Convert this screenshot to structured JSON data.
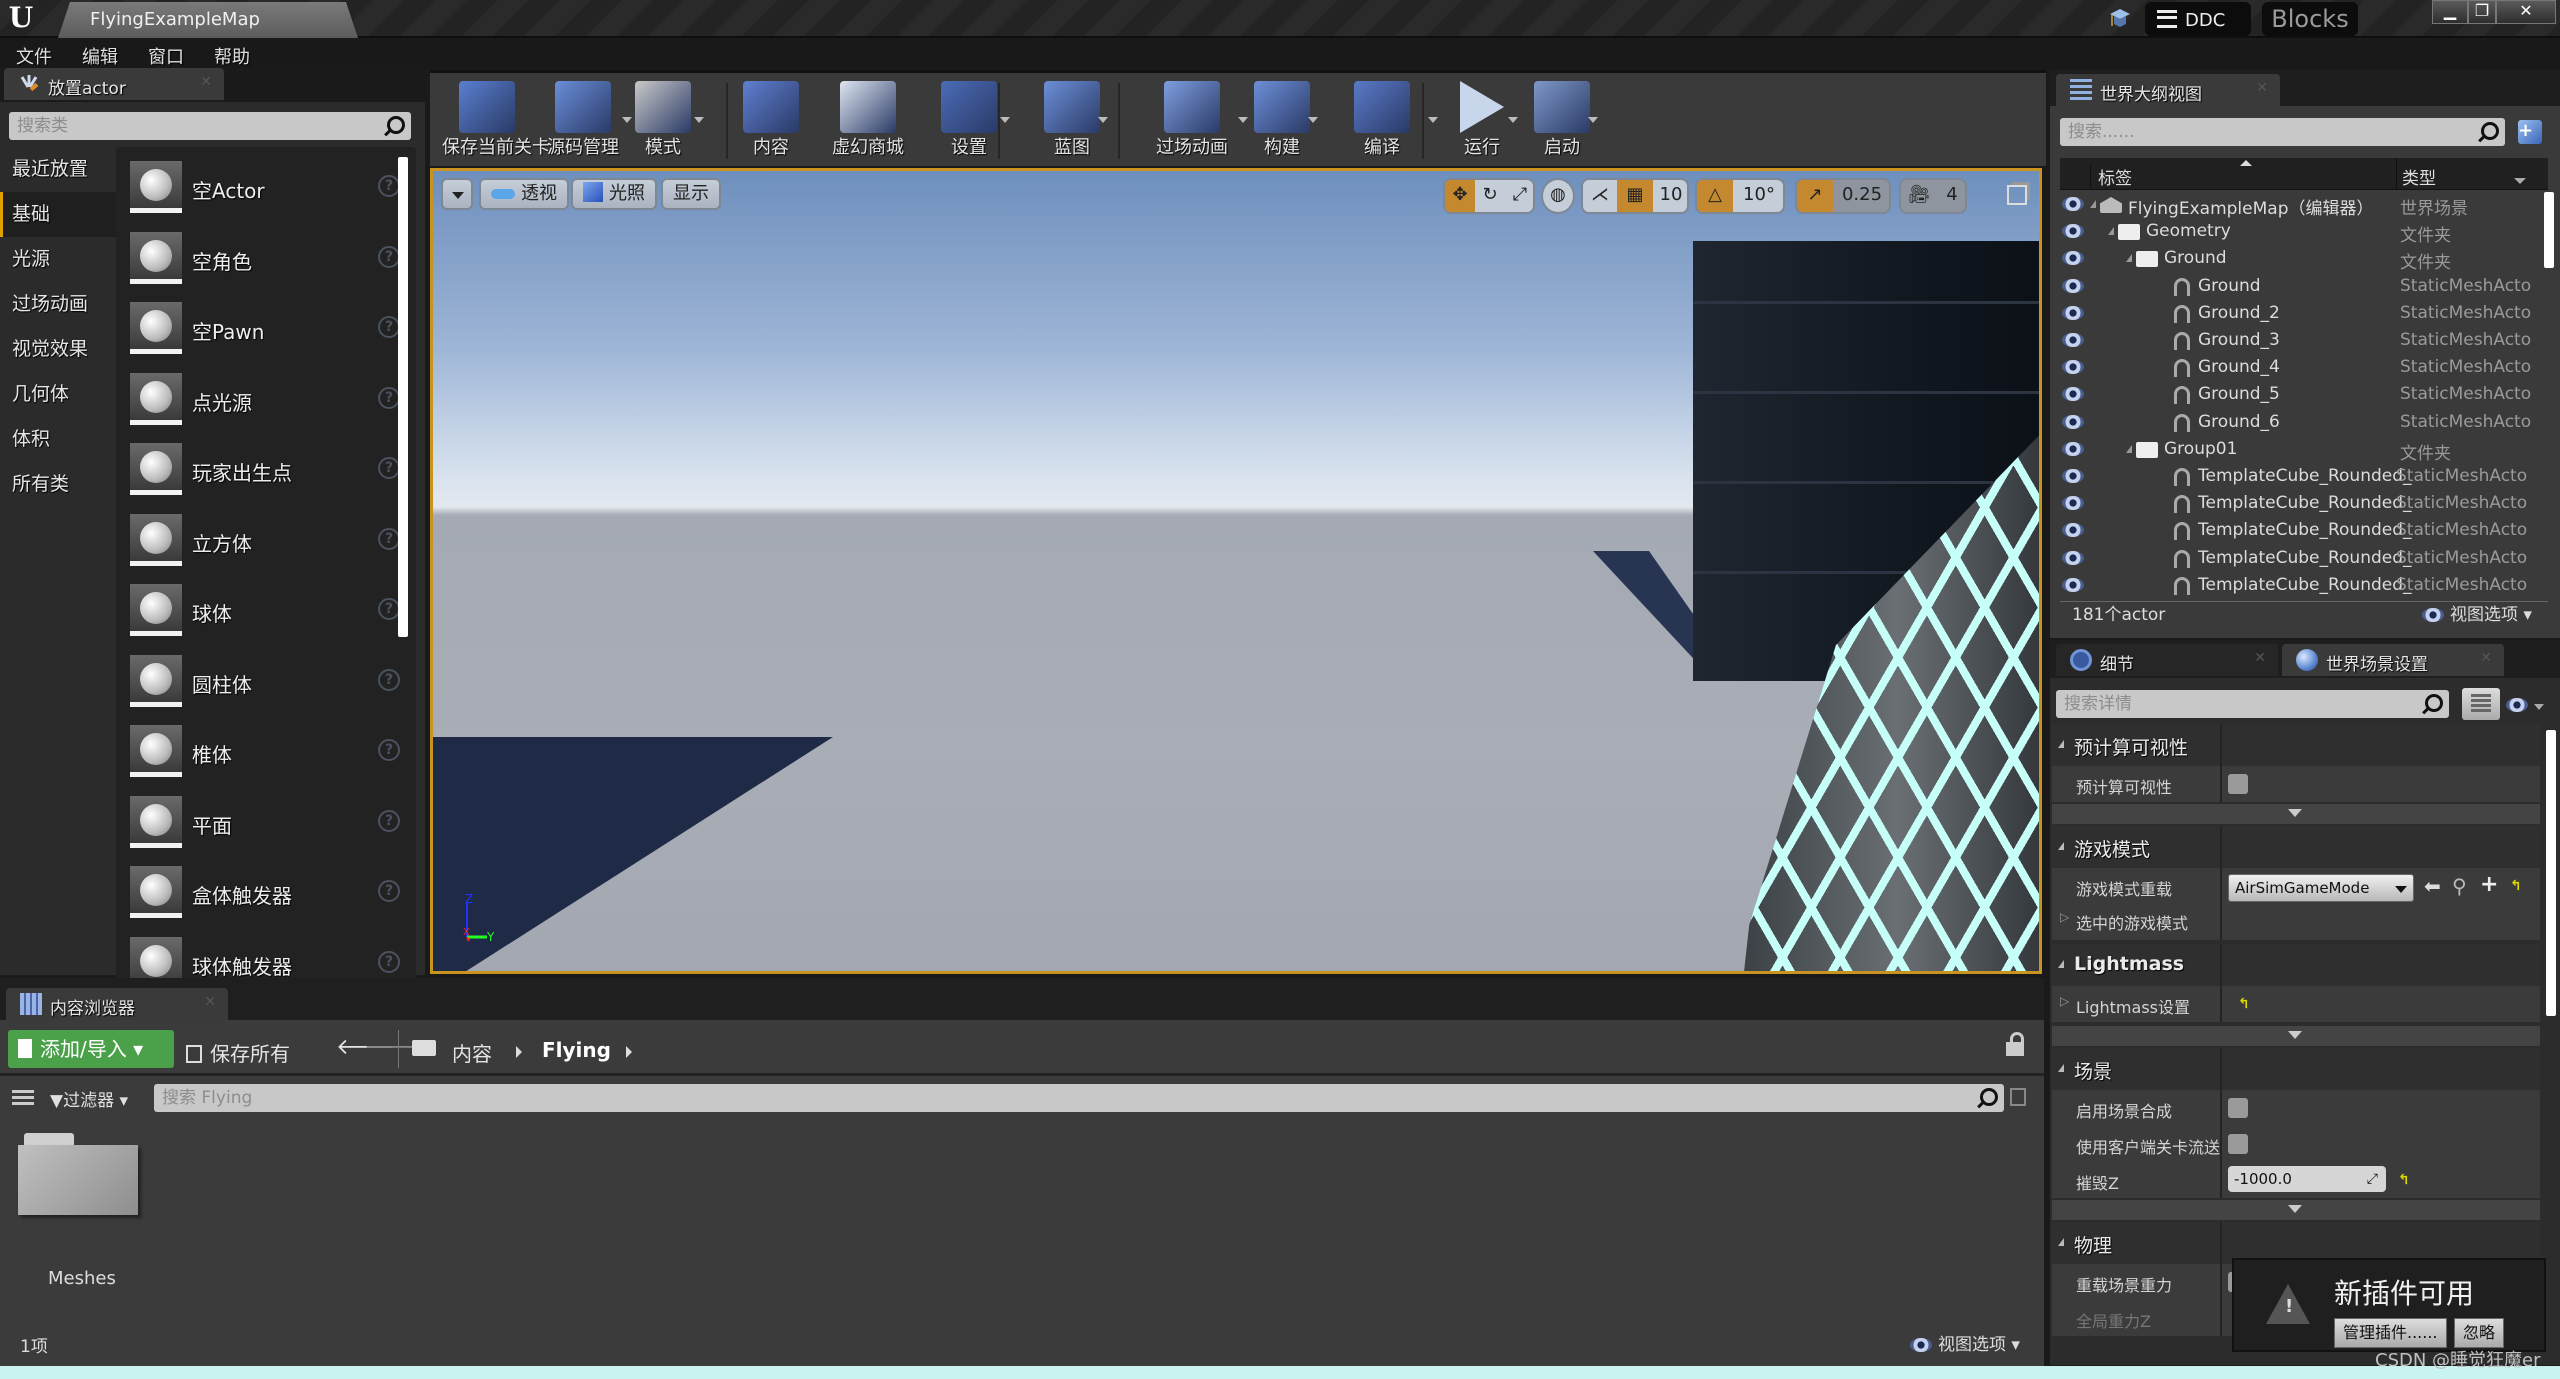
{
  "window": {
    "doc_tab": "FlyingExampleMap",
    "ddc_label": "DDC",
    "project_badge": "Blocks",
    "controls": {
      "minimize": "▁",
      "restore": "❐",
      "close": "✕"
    }
  },
  "menu": [
    "文件",
    "编辑",
    "窗口",
    "帮助"
  ],
  "place_actor": {
    "tab_label": "放置actor",
    "search_placeholder": "搜索类",
    "categories": [
      {
        "label": "最近放置",
        "active": false
      },
      {
        "label": "基础",
        "active": true
      },
      {
        "label": "光源",
        "active": false
      },
      {
        "label": "过场动画",
        "active": false
      },
      {
        "label": "视觉效果",
        "active": false
      },
      {
        "label": "几何体",
        "active": false
      },
      {
        "label": "体积",
        "active": false
      },
      {
        "label": "所有类",
        "active": false
      }
    ],
    "actors": [
      {
        "name": "空Actor",
        "icon": "sphere-icon"
      },
      {
        "name": "空角色",
        "icon": "mannequin-icon"
      },
      {
        "name": "空Pawn",
        "icon": "pawn-icon"
      },
      {
        "name": "点光源",
        "icon": "lightbulb-icon"
      },
      {
        "name": "玩家出生点",
        "icon": "player-start-icon"
      },
      {
        "name": "立方体",
        "icon": "cube-icon"
      },
      {
        "name": "球体",
        "icon": "sphere-icon"
      },
      {
        "name": "圆柱体",
        "icon": "cylinder-icon"
      },
      {
        "name": "椎体",
        "icon": "cone-icon"
      },
      {
        "name": "平面",
        "icon": "plane-icon"
      },
      {
        "name": "盒体触发器",
        "icon": "box-trigger-icon"
      },
      {
        "name": "球体触发器",
        "icon": "sphere-trigger-icon"
      }
    ],
    "help_glyph": "?"
  },
  "toolbar": {
    "buttons": [
      {
        "label": "保存当前关卡",
        "icon": "save-icon",
        "dropdown": false
      },
      {
        "label": "源码管理",
        "icon": "source-control-icon",
        "dropdown": true
      },
      {
        "label": "模式",
        "icon": "modes-icon",
        "dropdown": true
      },
      {
        "label": "内容",
        "icon": "content-icon",
        "dropdown": false
      },
      {
        "label": "虚幻商城",
        "icon": "marketplace-icon",
        "dropdown": false
      },
      {
        "label": "设置",
        "icon": "settings-icon",
        "dropdown": true
      },
      {
        "label": "蓝图",
        "icon": "blueprint-icon",
        "dropdown": true
      },
      {
        "label": "过场动画",
        "icon": "cinematics-icon",
        "dropdown": true
      },
      {
        "label": "构建",
        "icon": "build-icon",
        "dropdown": true
      },
      {
        "label": "编译",
        "icon": "compile-icon",
        "dropdown": true
      },
      {
        "label": "运行",
        "icon": "play-icon",
        "dropdown": true
      },
      {
        "label": "启动",
        "icon": "launch-icon",
        "dropdown": true
      }
    ]
  },
  "viewport": {
    "perspective_label": "透视",
    "lighting_label": "光照",
    "show_label": "显示",
    "grid_snap": "10",
    "rotation_snap": "10°",
    "scale_snap": "0.25",
    "camera_speed": "4",
    "axis_labels": {
      "z": "Z",
      "x": "X",
      "y": "Y"
    }
  },
  "outliner": {
    "tab_label": "世界大纲视图",
    "search_placeholder": "搜索......",
    "col_label": "标签",
    "col_type": "类型",
    "rows": [
      {
        "label": "FlyingExampleMap（编辑器）",
        "type": "世界场景",
        "depth": 0,
        "kind": "world"
      },
      {
        "label": "Geometry",
        "type": "文件夹",
        "depth": 1,
        "kind": "folder"
      },
      {
        "label": "Ground",
        "type": "文件夹",
        "depth": 2,
        "kind": "folder"
      },
      {
        "label": "Ground",
        "type": "StaticMeshActo",
        "depth": 3,
        "kind": "mesh"
      },
      {
        "label": "Ground_2",
        "type": "StaticMeshActo",
        "depth": 3,
        "kind": "mesh"
      },
      {
        "label": "Ground_3",
        "type": "StaticMeshActo",
        "depth": 3,
        "kind": "mesh"
      },
      {
        "label": "Ground_4",
        "type": "StaticMeshActo",
        "depth": 3,
        "kind": "mesh"
      },
      {
        "label": "Ground_5",
        "type": "StaticMeshActo",
        "depth": 3,
        "kind": "mesh"
      },
      {
        "label": "Ground_6",
        "type": "StaticMeshActo",
        "depth": 3,
        "kind": "mesh"
      },
      {
        "label": "Group01",
        "type": "文件夹",
        "depth": 2,
        "kind": "folder"
      },
      {
        "label": "TemplateCube_Rounded_",
        "type": "StaticMeshActo",
        "depth": 3,
        "kind": "mesh"
      },
      {
        "label": "TemplateCube_Rounded_",
        "type": "StaticMeshActo",
        "depth": 3,
        "kind": "mesh"
      },
      {
        "label": "TemplateCube_Rounded_",
        "type": "StaticMeshActo",
        "depth": 3,
        "kind": "mesh"
      },
      {
        "label": "TemplateCube_Rounded_",
        "type": "StaticMeshActo",
        "depth": 3,
        "kind": "mesh"
      },
      {
        "label": "TemplateCube_Rounded_",
        "type": "StaticMeshActo",
        "depth": 3,
        "kind": "mesh"
      }
    ],
    "actor_count": "181个actor",
    "view_options": "视图选项"
  },
  "details": {
    "tab_details": "细节",
    "tab_world_settings": "世界场景设置",
    "search_placeholder": "搜索详情",
    "sections": {
      "precomputed": {
        "title": "预计算可视性",
        "row": "预计算可视性"
      },
      "game_mode": {
        "title": "游戏模式",
        "override_label": "游戏模式重载",
        "override_value": "AirSimGameMode",
        "selected_label": "选中的游戏模式"
      },
      "lightmass": {
        "title": "Lightmass",
        "settings_label": "Lightmass设置"
      },
      "world": {
        "title": "场景",
        "composition_label": "启用场景合成",
        "streaming_label": "使用客户端关卡流送",
        "killz_label": "摧毁Z",
        "killz_value": "-1000.0"
      },
      "physics": {
        "title": "物理",
        "override_gravity_label": "重载场景重力",
        "global_gravity_label": "全局重力Z"
      }
    }
  },
  "toast": {
    "title": "新插件可用",
    "manage_label": "管理插件......",
    "dismiss_label": "忽略"
  },
  "content_browser": {
    "tab_label": "内容浏览器",
    "add_import": "添加/导入",
    "save_all": "保存所有",
    "breadcrumb": [
      "内容",
      "Flying"
    ],
    "filters_label": "过滤器",
    "search_placeholder": "搜索 Flying",
    "items": [
      {
        "name": "Meshes",
        "kind": "folder"
      }
    ],
    "item_count": "1项",
    "view_options": "视图选项"
  },
  "watermark": "CSDN @睡觉狂魔er"
}
